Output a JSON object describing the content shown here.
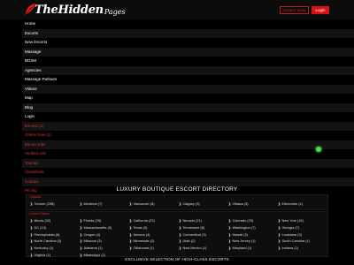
{
  "header": {
    "logo_main": "TheHidden",
    "logo_tail": "Pages",
    "signup_label": "SIGNUP NOW",
    "login_label": "Login"
  },
  "menu": [
    {
      "label": "Home",
      "color": "white"
    },
    {
      "label": "Escorts",
      "color": "white"
    },
    {
      "label": "New Escorts",
      "color": "white"
    },
    {
      "label": "Massage",
      "color": "white"
    },
    {
      "label": "BDSM",
      "color": "white"
    },
    {
      "label": "Agencies",
      "color": "white"
    },
    {
      "label": "Massage Parlours",
      "color": "white"
    },
    {
      "label": "Videos",
      "color": "white"
    },
    {
      "label": "Map",
      "color": "white"
    },
    {
      "label": "Blog",
      "color": "white"
    },
    {
      "label": "Login",
      "color": "white"
    },
    {
      "label": "Escorts (1)",
      "color": "red"
    },
    {
      "label": "Online Now (1)",
      "color": "red"
    },
    {
      "label": "Escort Jobs",
      "color": "red"
    },
    {
      "label": "Verified Ads",
      "color": "red"
    },
    {
      "label": "Touring",
      "color": "red"
    },
    {
      "label": "Classifieds",
      "color": "red"
    },
    {
      "label": "Contact",
      "color": "red"
    },
    {
      "label": "Pricing",
      "color": "red"
    }
  ],
  "directory": {
    "title": "LUXURY BOUTIQUE ESCORT DIRECTORY",
    "canada_label": "Canada",
    "canada_cities": [
      "Toronto (298)",
      "Montreal (7)",
      "Vancouver (8)",
      "Calgary (3)",
      "Ottawa (3)",
      "Edmonton (1)"
    ],
    "usa_label": "United States",
    "usa_cities": [
      "Illinois (32)",
      "Florida (29)",
      "California (22)",
      "Nevada (21)",
      "Colorado (20)",
      "New York (16)",
      "DC (13)",
      "Massachusetts (9)",
      "Texas (9)",
      "Tennessee (8)",
      "Washington (7)",
      "Georgia (7)",
      "Pennsylvania (6)",
      "Oregon (4)",
      "Arizona (4)",
      "Connecticut (3)",
      "Hawaii (3)",
      "Louisiana (3)",
      "North Carolina (3)",
      "Missouri (3)",
      "Minnesota (2)",
      "Utah (2)",
      "New Jersey (1)",
      "South Carolina (1)",
      "Kentucky (1)",
      "Alabama (1)",
      "Oklahoma (1)",
      "New Mexico (1)",
      "Maryland (1)",
      "Indiana (1)",
      "Virginia (1)",
      "Mississippi (1)"
    ]
  },
  "footer": {
    "title": "EXCLUSIVE SELECTION OF HIGH-CLASS ESCORTS"
  },
  "colors": {
    "accent": "#d41414",
    "menu_red": "#d83434",
    "online_dot": "#48e24c"
  },
  "icons": [
    "logo-feather-icon",
    "chevron-right-icon",
    "online-status-dot-icon"
  ]
}
